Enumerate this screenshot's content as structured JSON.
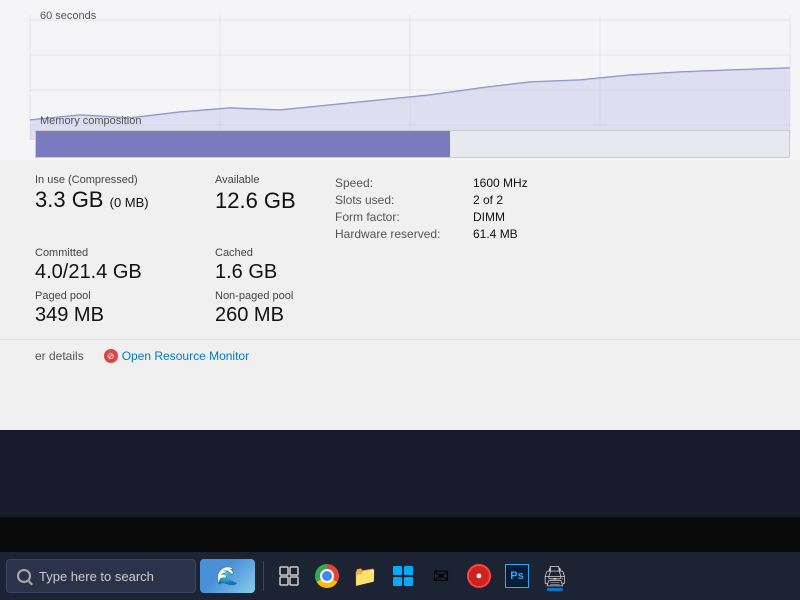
{
  "graph": {
    "time_label": "60 seconds",
    "memory_composition_label": "Memory composition"
  },
  "stats": {
    "in_use_label": "In use (Compressed)",
    "in_use_value": "3.3 GB",
    "compressed_value": "(0 MB)",
    "available_label": "Available",
    "available_value": "12.6 GB",
    "committed_label": "Committed",
    "committed_value": "4.0/21.4 GB",
    "cached_label": "Cached",
    "cached_value": "1.6 GB",
    "paged_pool_label": "Paged pool",
    "paged_pool_value": "349 MB",
    "non_paged_pool_label": "Non-paged pool",
    "non_paged_pool_value": "260 MB",
    "speed_label": "Speed:",
    "speed_value": "1600 MHz",
    "slots_label": "Slots used:",
    "slots_value": "2 of 2",
    "form_factor_label": "Form factor:",
    "form_factor_value": "DIMM",
    "hw_reserved_label": "Hardware reserved:",
    "hw_reserved_value": "61.4 MB"
  },
  "bottom_links": {
    "left_text": "er details",
    "open_resource_monitor": "Open Resource Monitor"
  },
  "taskbar": {
    "search_placeholder": "Type here to search",
    "icons": [
      {
        "name": "task-view",
        "label": "Task View"
      },
      {
        "name": "chrome",
        "label": "Google Chrome"
      },
      {
        "name": "file-explorer",
        "label": "File Explorer"
      },
      {
        "name": "windows-store",
        "label": "Microsoft Store"
      },
      {
        "name": "mail",
        "label": "Mail"
      },
      {
        "name": "red-app",
        "label": "App"
      },
      {
        "name": "photoshop",
        "label": "Photoshop"
      },
      {
        "name": "printer",
        "label": "Printer/Device"
      }
    ]
  }
}
